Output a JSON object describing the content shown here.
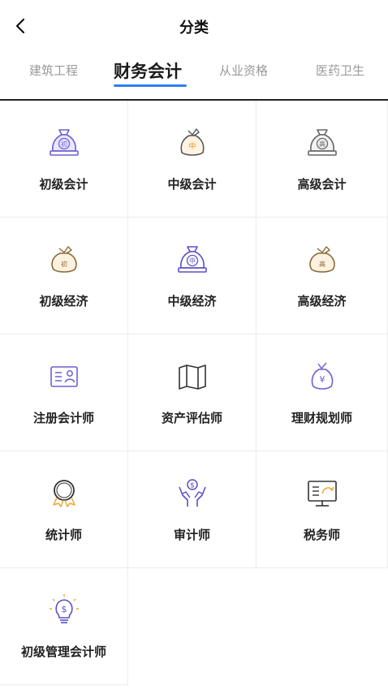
{
  "header": {
    "title": "分类",
    "back_icon": "chevron-left-icon"
  },
  "tabs": [
    {
      "label": "建筑工程",
      "active": false
    },
    {
      "label": "财务会计",
      "active": true
    },
    {
      "label": "从业资格",
      "active": false
    },
    {
      "label": "医药卫生",
      "active": false
    }
  ],
  "accent_color": "#2f7ff5",
  "categories": [
    {
      "label": "初级会计",
      "icon": "money-bag-chu-icon"
    },
    {
      "label": "中级会计",
      "icon": "money-bag-zhong-icon"
    },
    {
      "label": "高级会计",
      "icon": "money-bag-gao-icon"
    },
    {
      "label": "初级经济",
      "icon": "money-sack-chu-icon"
    },
    {
      "label": "中级经济",
      "icon": "money-bag-zhong-purple-icon"
    },
    {
      "label": "高级经济",
      "icon": "money-sack-gao-icon"
    },
    {
      "label": "注册会计师",
      "icon": "id-card-icon"
    },
    {
      "label": "资产评估师",
      "icon": "map-icon"
    },
    {
      "label": "理财规划师",
      "icon": "yen-bag-icon"
    },
    {
      "label": "统计师",
      "icon": "medal-icon"
    },
    {
      "label": "审计师",
      "icon": "hands-coin-icon"
    },
    {
      "label": "税务师",
      "icon": "monitor-chart-icon"
    },
    {
      "label": "初级管理会计师",
      "icon": "lightbulb-dollar-icon"
    }
  ],
  "icon_glyphs": {
    "chu": "初",
    "zhong": "中",
    "gao": "高",
    "yen": "¥",
    "dollar": "$"
  }
}
